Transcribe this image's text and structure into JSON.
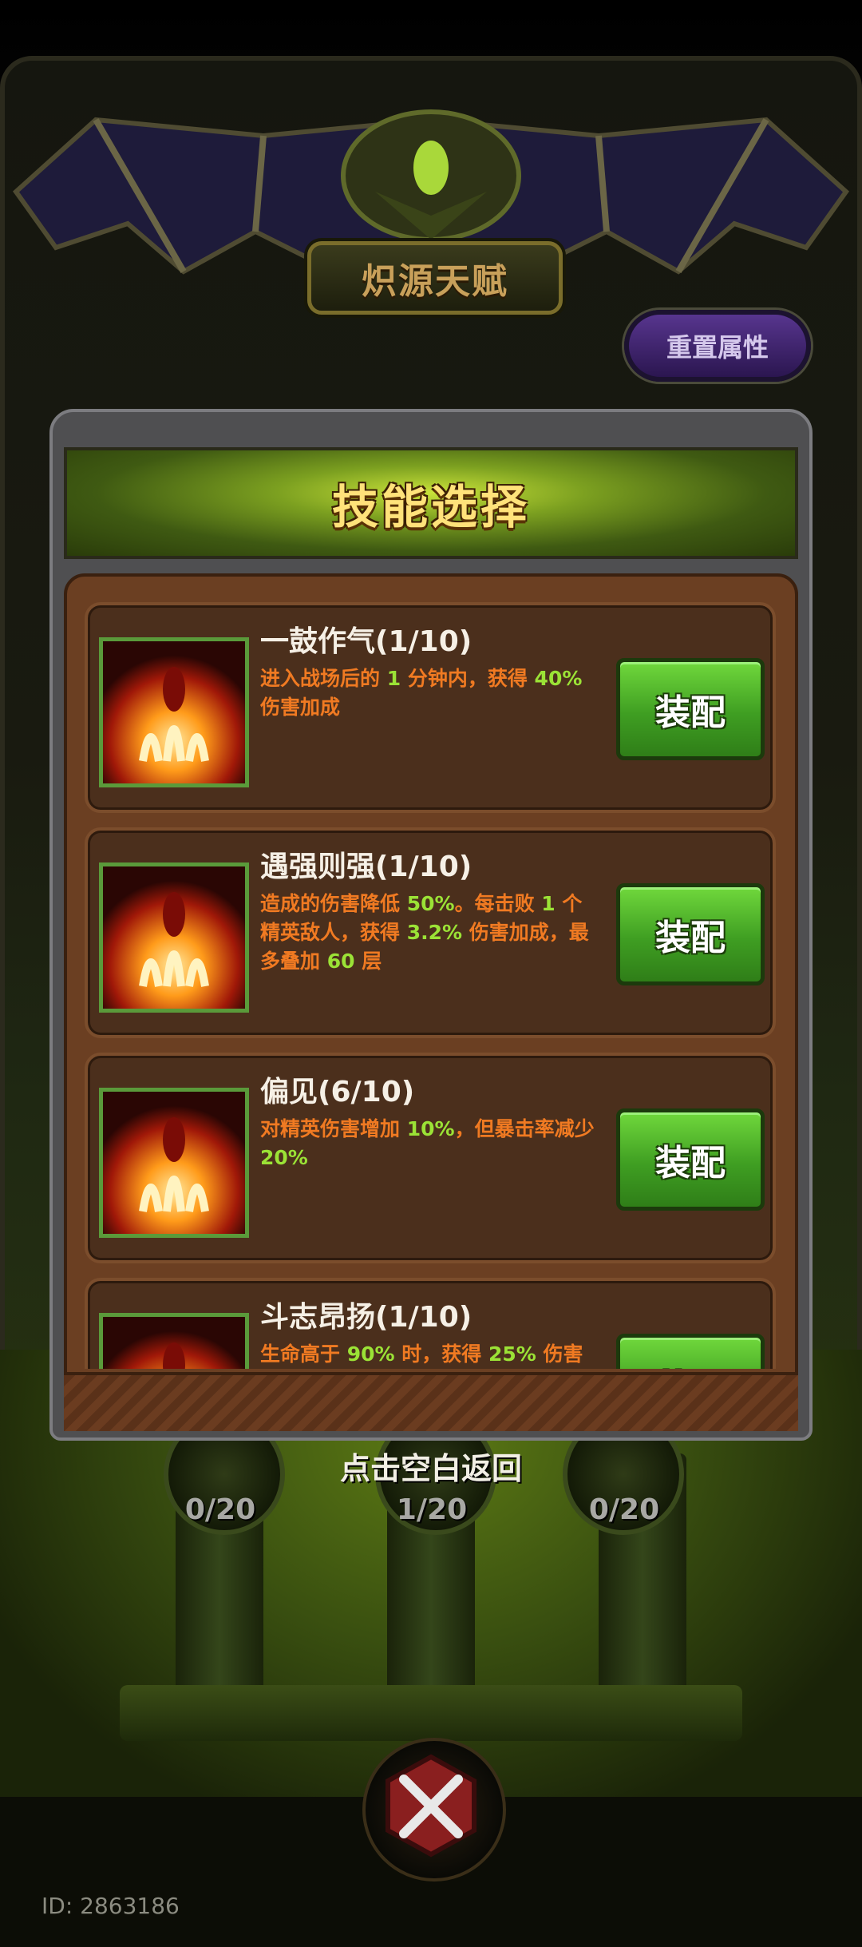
{
  "header": {
    "title": "炽源天赋",
    "reset_button": "重置属性"
  },
  "modal": {
    "title": "技能选择",
    "skills": [
      {
        "name": "一鼓作气(1/10)",
        "desc": [
          {
            "t": "进入战场后的 ",
            "hl": false
          },
          {
            "t": "1",
            "hl": true
          },
          {
            "t": " 分钟内，获得 ",
            "hl": false
          },
          {
            "t": "40%",
            "hl": true
          },
          {
            "t": " 伤害加成",
            "hl": false
          }
        ],
        "button": "装配"
      },
      {
        "name": "遇强则强(1/10)",
        "desc": [
          {
            "t": "造成的伤害降低 ",
            "hl": false
          },
          {
            "t": "50%",
            "hl": true
          },
          {
            "t": "。每击败 ",
            "hl": false
          },
          {
            "t": "1",
            "hl": true
          },
          {
            "t": " 个精英敌人，获得 ",
            "hl": false
          },
          {
            "t": "3.2%",
            "hl": true
          },
          {
            "t": " 伤害加成，最多叠加 ",
            "hl": false
          },
          {
            "t": "60",
            "hl": true
          },
          {
            "t": " 层",
            "hl": false
          }
        ],
        "button": "装配"
      },
      {
        "name": "偏见(6/10)",
        "desc": [
          {
            "t": "对精英伤害增加 ",
            "hl": false
          },
          {
            "t": "10%",
            "hl": true
          },
          {
            "t": "，但暴击率减少 ",
            "hl": false
          },
          {
            "t": "20%",
            "hl": true
          }
        ],
        "button": "装配"
      },
      {
        "name": "斗志昂扬(1/10)",
        "desc": [
          {
            "t": "生命高于 ",
            "hl": false
          },
          {
            "t": "90%",
            "hl": true
          },
          {
            "t": " 时，获得 ",
            "hl": false
          },
          {
            "t": "25%",
            "hl": true
          },
          {
            "t": " 伤害",
            "hl": false
          }
        ],
        "button": "装配"
      }
    ]
  },
  "hint": "点击空白返回",
  "counters": [
    "0/20",
    "1/20",
    "0/20"
  ],
  "id_label": "ID: 2863186",
  "colors": {
    "desc_orange": "#f07a22",
    "desc_highlight": "#9be236",
    "equip_green": "#3f9e22",
    "reset_purple": "#57358e"
  }
}
